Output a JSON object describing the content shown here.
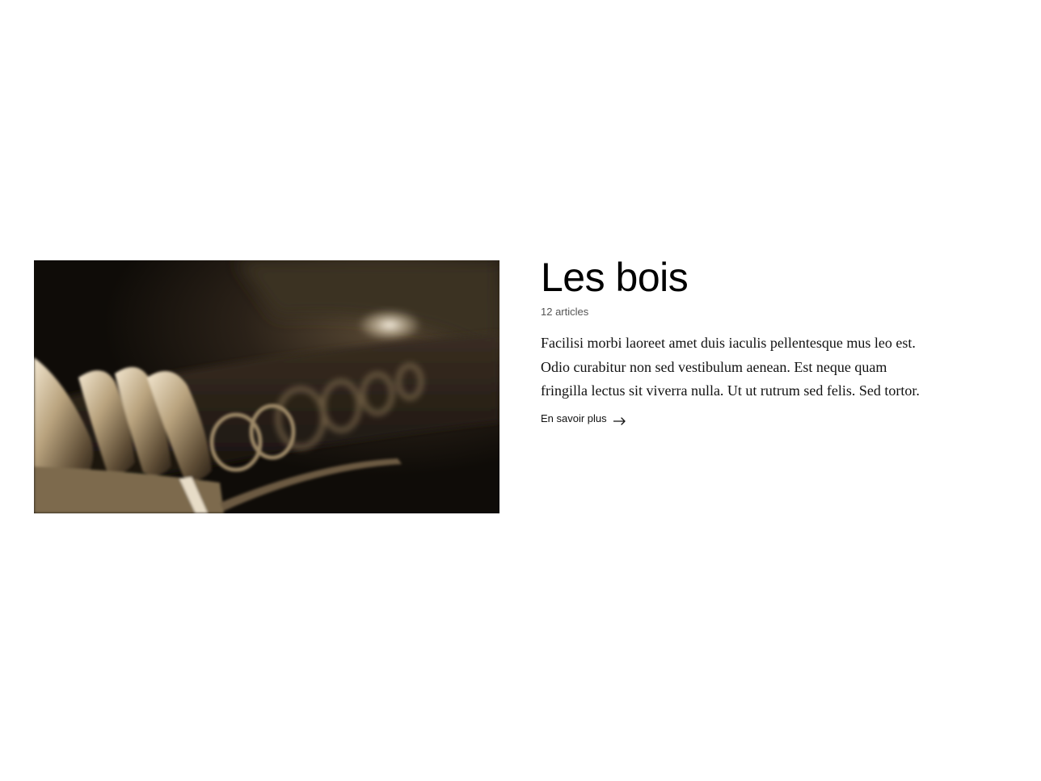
{
  "category": {
    "image_alt": "clarinet-keys-photo",
    "title": "Les bois",
    "count": "12 articles",
    "description": "Facilisi morbi laoreet amet duis iaculis pellentesque mus leo est. Odio curabitur non sed vestibulum aenean. Est neque quam fringilla lectus sit viverra nulla. Ut ut rutrum sed felis. Sed tortor.",
    "link_label": "En savoir plus",
    "link_icon": "arrow-right-icon"
  },
  "colors": {
    "text": "#000000",
    "muted": "#555555",
    "background": "#ffffff"
  }
}
